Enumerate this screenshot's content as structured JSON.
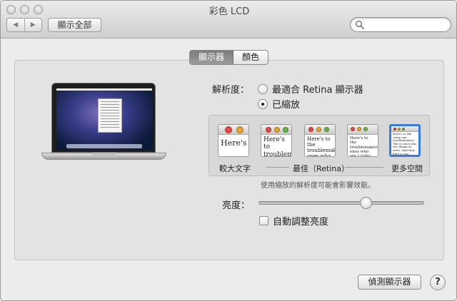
{
  "window": {
    "title": "彩色 LCD"
  },
  "toolbar": {
    "back_icon": "chevron-left-icon",
    "forward_icon": "chevron-right-icon",
    "show_all_label": "顯示全部",
    "search_placeholder": "",
    "search_icon": "search-icon"
  },
  "tabs": [
    {
      "label": "顯示器",
      "active": true
    },
    {
      "label": "顏色",
      "active": false
    }
  ],
  "resolution": {
    "label": "解析度：",
    "options": [
      {
        "label": "最適合 Retina 顯示器",
        "selected": false
      },
      {
        "label": "已縮放",
        "selected": true
      }
    ],
    "scaled": {
      "thumbnails": [
        {
          "text": "Here's",
          "selected": false
        },
        {
          "text": "Here's to troublem",
          "selected": false
        },
        {
          "text": "Here's to the troublemak ones who se",
          "selected": false
        },
        {
          "text": "Here's to the troublemakers. ones who see t rules. And they",
          "selected": false
        },
        {
          "text": "Here's to the crazy one troublemakers. The ro ones who see things di rules. And they have n can quote them, disagr them. About the only th Because they change t",
          "selected": true
        }
      ],
      "left_caption": "較大文字",
      "center_caption": "最佳（Retina）",
      "right_caption": "更多空間"
    },
    "note": "使用縮放的解析度可能會影響效能。"
  },
  "brightness": {
    "label": "亮度：",
    "level": 0.65,
    "auto_label": "自動調整亮度",
    "auto_checked": false
  },
  "footer": {
    "detect_label": "偵測顯示器",
    "help_label": "?"
  },
  "colors": {
    "selection_blue": "#3a7ad9",
    "traffic_red": "#e14b44",
    "traffic_yellow": "#e8a431",
    "traffic_green": "#6db146"
  }
}
